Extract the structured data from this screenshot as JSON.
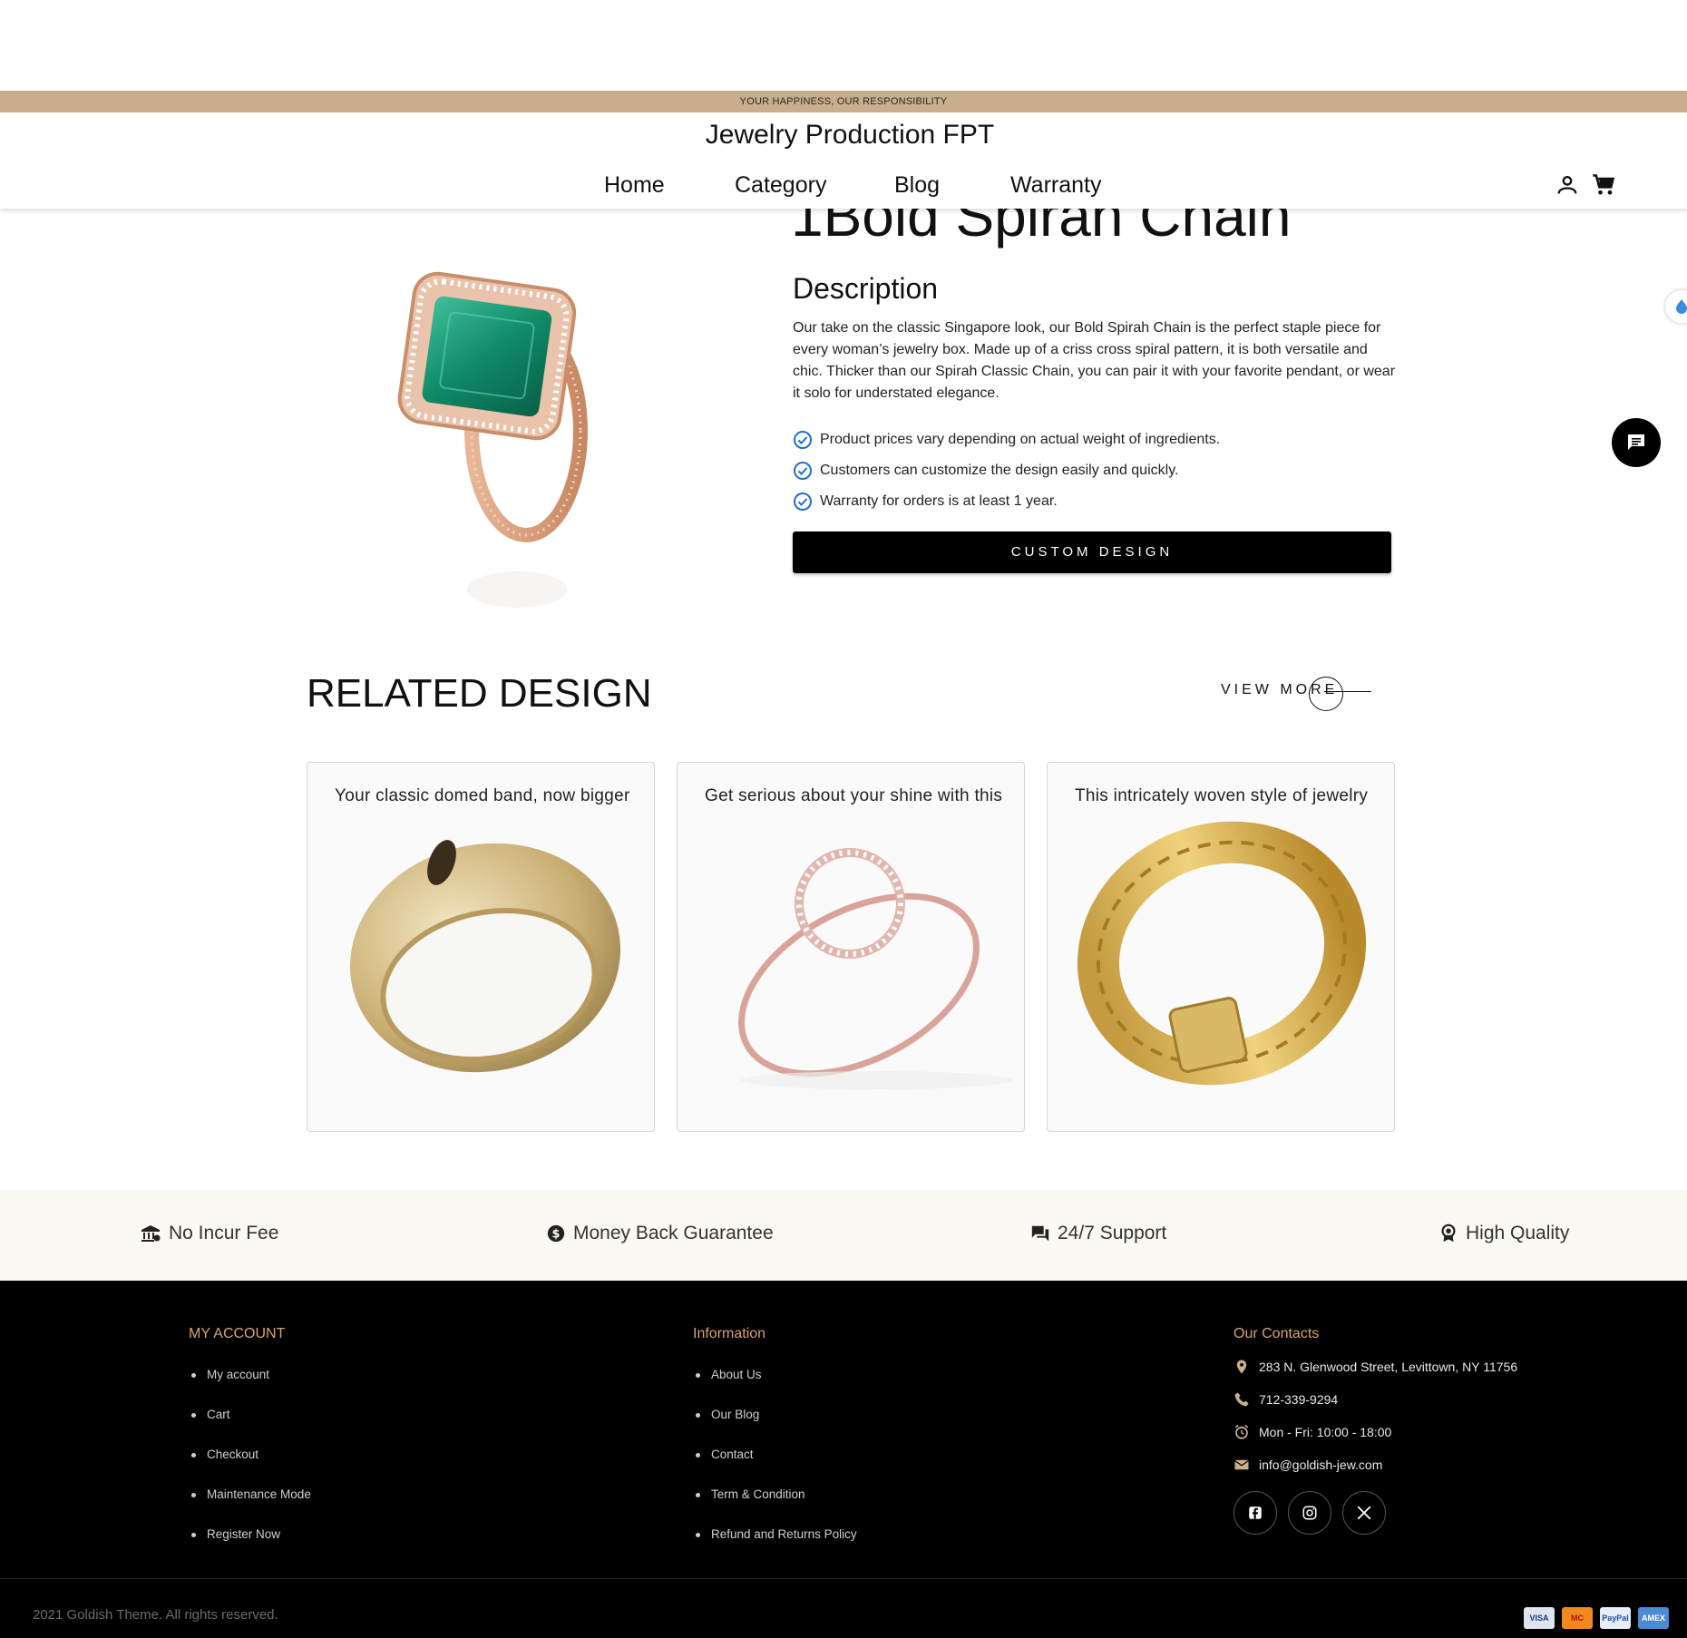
{
  "topbar": {
    "tagline": "YOUR HAPPINESS, OUR RESPONSIBILITY"
  },
  "header": {
    "brand": "Jewelry Production FPT",
    "nav": [
      "Home",
      "Category",
      "Blog",
      "Warranty"
    ]
  },
  "product": {
    "title": "1Bold Spirah Chain",
    "description_heading": "Description",
    "description": "Our take on the classic Singapore look, our Bold Spirah Chain is the perfect staple piece for every woman’s jewelry box. Made up of a criss cross spiral pattern, it is both versatile and chic. Thicker than our Spirah Classic Chain, you can pair it with your favorite pendant, or wear it solo for understated elegance.",
    "checklist": [
      "Product prices vary depending on actual weight of ingredients.",
      "Customers can customize the design easily and quickly.",
      "Warranty for orders is at least 1 year."
    ],
    "cta_label": "CUSTOM DESIGN"
  },
  "related": {
    "heading": "RELATED DESIGN",
    "view_more": "VIEW MORE",
    "cards": [
      {
        "title": "Your classic domed band, now bigger"
      },
      {
        "title": "Get serious about your shine with this"
      },
      {
        "title": "This intricately woven style of jewelry"
      }
    ]
  },
  "features": [
    "No Incur Fee",
    "Money Back Guarantee",
    "24/7 Support",
    "High Quality"
  ],
  "footer": {
    "my_account": {
      "heading": "MY ACCOUNT",
      "links": [
        "My account",
        "Cart",
        "Checkout",
        "Maintenance Mode",
        "Register Now"
      ]
    },
    "information": {
      "heading": "Information",
      "links": [
        "About Us",
        "Our Blog",
        "Contact",
        "Term & Condition",
        "Refund and Returns Policy"
      ]
    },
    "contacts": {
      "heading": "Our Contacts",
      "address": "283 N. Glenwood Street, Levittown, NY 11756",
      "phone": "712-339-9294",
      "hours": "Mon - Fri: 10:00 - 18:00",
      "email": "info@goldish-jew.com"
    },
    "social": [
      "facebook-icon",
      "instagram-icon",
      "x-icon"
    ],
    "copyright": "2021 Goldish Theme. All rights reserved.",
    "payments": [
      "VISA",
      "MC",
      "PayPal",
      "AMEX"
    ]
  },
  "colors": {
    "accent": "#c8ae8d",
    "footer_heading": "#d9a36a",
    "check": "#1e6fd9"
  }
}
